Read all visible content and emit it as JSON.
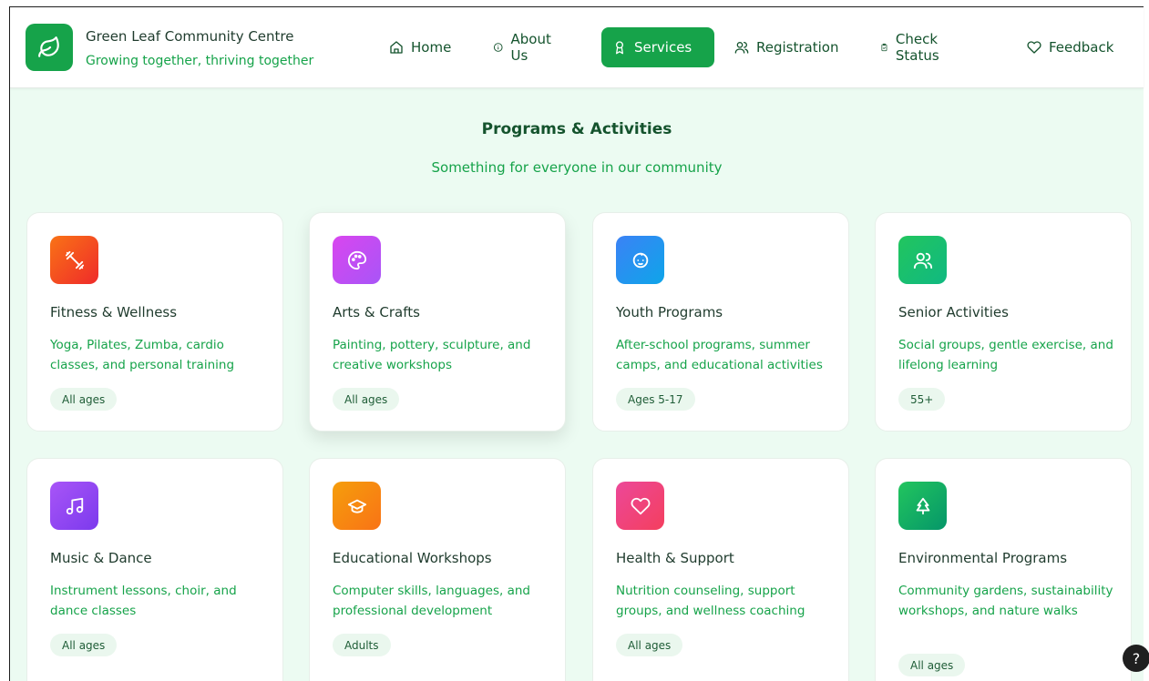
{
  "brand": {
    "title": "Green Leaf Community Centre",
    "tagline": "Growing together, thriving together",
    "logo_icon": "leaf-icon",
    "accent": "#16a34a"
  },
  "nav": {
    "items": [
      {
        "label": "Home",
        "icon": "home-icon",
        "active": false
      },
      {
        "label": "About Us",
        "icon": "info-icon",
        "active": false
      },
      {
        "label": "Services",
        "icon": "award-icon",
        "active": true
      },
      {
        "label": "Registration",
        "icon": "users-icon",
        "active": false
      },
      {
        "label": "Check Status",
        "icon": "clipboard-check-icon",
        "active": false
      },
      {
        "label": "Feedback",
        "icon": "heart-icon",
        "active": false
      }
    ]
  },
  "section": {
    "title": "Programs & Activities",
    "subtitle": "Something for everyone in our community"
  },
  "programs": [
    {
      "title": "Fitness & Wellness",
      "description": "Yoga, Pilates, Zumba, cardio classes, and personal training",
      "badge": "All ages",
      "icon": "dumbbell-icon",
      "color": "#f43f1e"
    },
    {
      "title": "Arts & Crafts",
      "description": "Painting, pottery, sculpture, and creative workshops",
      "badge": "All ages",
      "icon": "palette-icon",
      "color": "#c03ad8"
    },
    {
      "title": "Youth Programs",
      "description": "After-school programs, summer camps, and educational activities",
      "badge": "Ages 5-17",
      "icon": "baby-icon",
      "color": "#1d7af0"
    },
    {
      "title": "Senior Activities",
      "description": "Social groups, gentle exercise, and lifelong learning",
      "badge": "55+",
      "icon": "users-icon",
      "color": "#16c25a"
    },
    {
      "title": "Music & Dance",
      "description": "Instrument lessons, choir, and dance classes",
      "badge": "All ages",
      "icon": "music-icon",
      "color": "#8a45f0"
    },
    {
      "title": "Educational Workshops",
      "description": "Computer skills, languages, and professional development",
      "badge": "Adults",
      "icon": "graduation-cap-icon",
      "color": "#f58a0b"
    },
    {
      "title": "Health & Support",
      "description": "Nutrition counseling, support groups, and wellness coaching",
      "badge": "All ages",
      "icon": "heart-icon",
      "color": "#ee2a72"
    },
    {
      "title": "Environmental Programs",
      "description": "Community gardens, sustainability workshops, and nature walks",
      "badge": "All ages",
      "icon": "tree-icon",
      "color": "#17a657"
    }
  ],
  "help": {
    "label": "?",
    "icon": "help-icon"
  }
}
